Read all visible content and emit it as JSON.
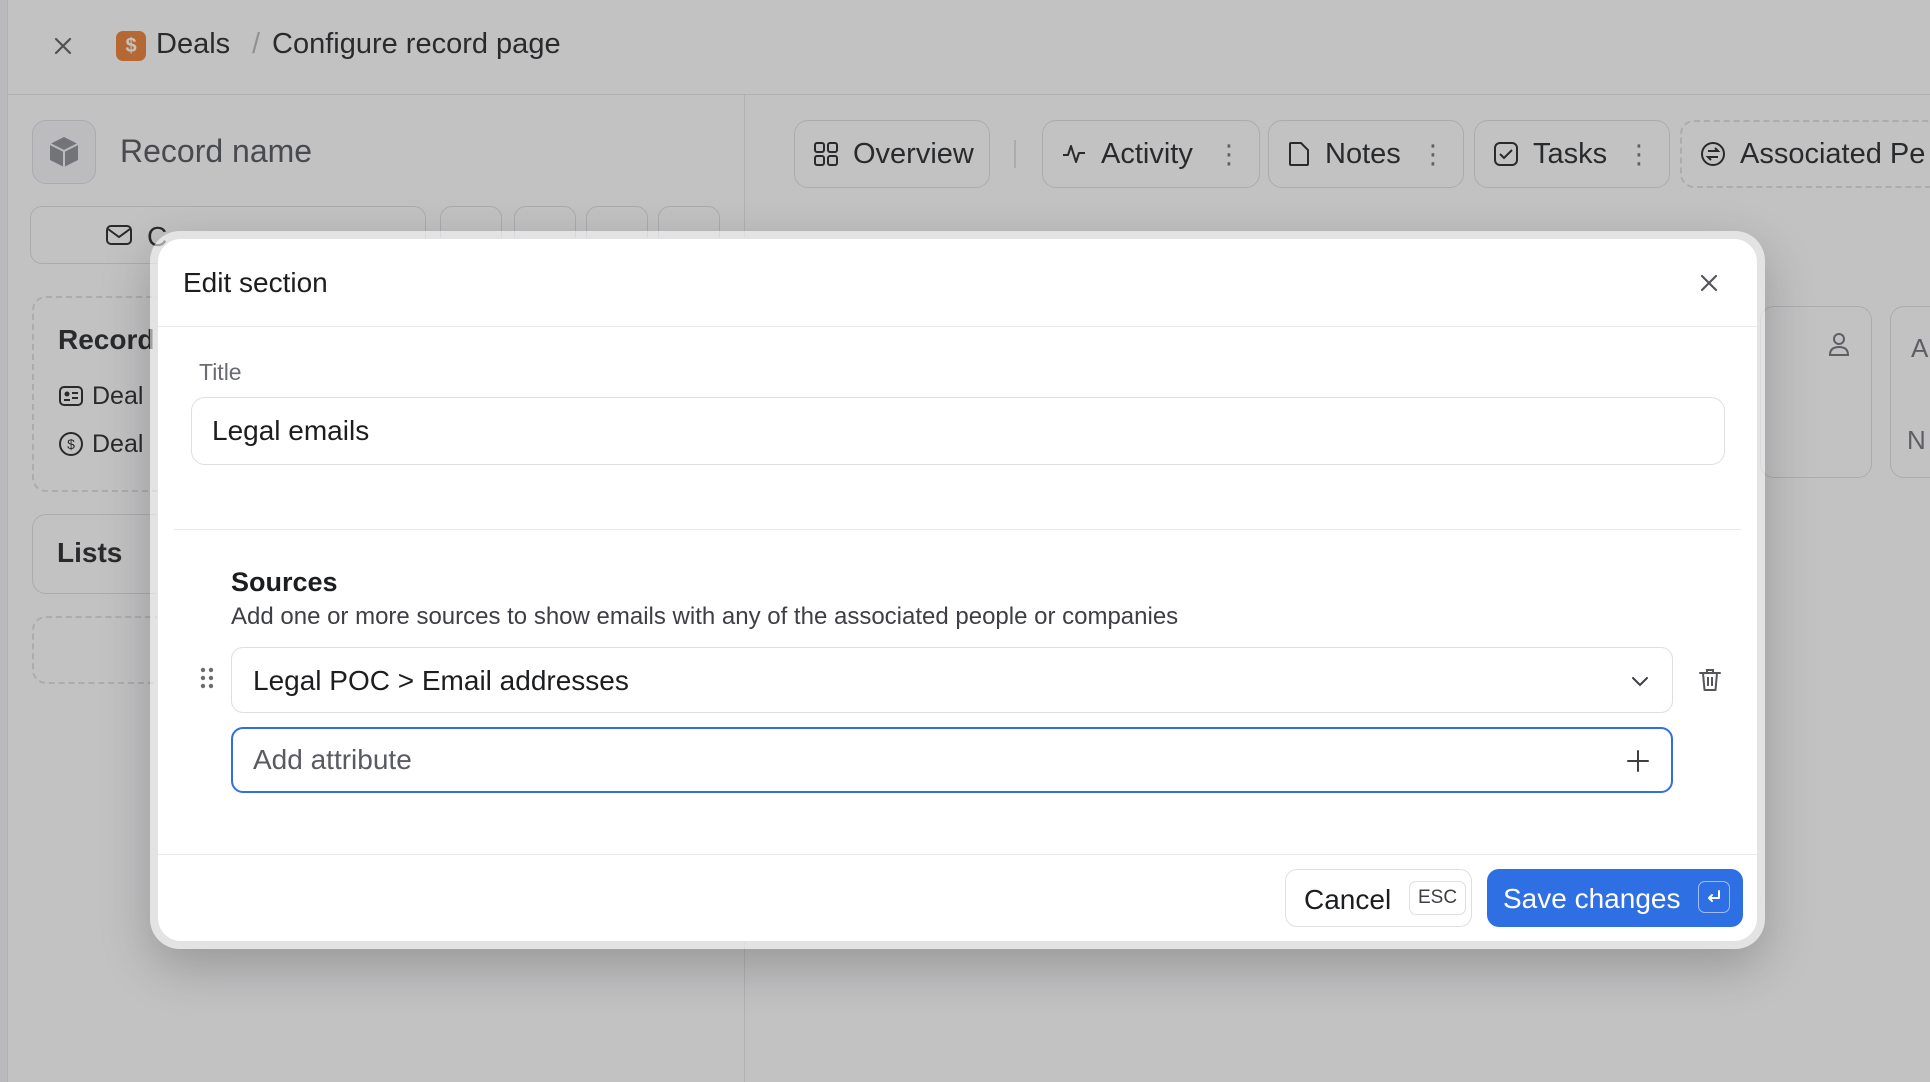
{
  "topbar": {
    "close_icon": "close-icon",
    "object_badge": "$",
    "breadcrumb_root": "Deals",
    "breadcrumb_separator": "/",
    "breadcrumb_page": "Configure record page"
  },
  "record": {
    "name_placeholder": "Record name",
    "action_label": "C"
  },
  "left_cards": {
    "record_title": "Record",
    "chips": [
      "Deal",
      "Deal"
    ],
    "lists_title": "Lists"
  },
  "tabs": [
    {
      "label": "Overview",
      "icon": "grid-icon"
    },
    {
      "label": "Activity",
      "icon": "activity-icon"
    },
    {
      "label": "Notes",
      "icon": "note-icon"
    },
    {
      "label": "Tasks",
      "icon": "checkbox-icon"
    },
    {
      "label": "Associated Pe",
      "icon": "associated-icon"
    }
  ],
  "right_cards": {
    "card2_a": "A",
    "card2_n": "N"
  },
  "modal": {
    "title": "Edit section",
    "title_field_label": "Title",
    "title_value": "Legal emails",
    "sources_title": "Sources",
    "sources_description": "Add one or more sources to show emails with any of the associated people or companies",
    "source_value": "Legal POC > Email addresses",
    "add_attribute_placeholder": "Add attribute",
    "cancel_label": "Cancel",
    "cancel_shortcut": "ESC",
    "save_label": "Save changes"
  },
  "colors": {
    "accent": "#2f6fe4",
    "deals_badge": "#ee7a2a"
  }
}
